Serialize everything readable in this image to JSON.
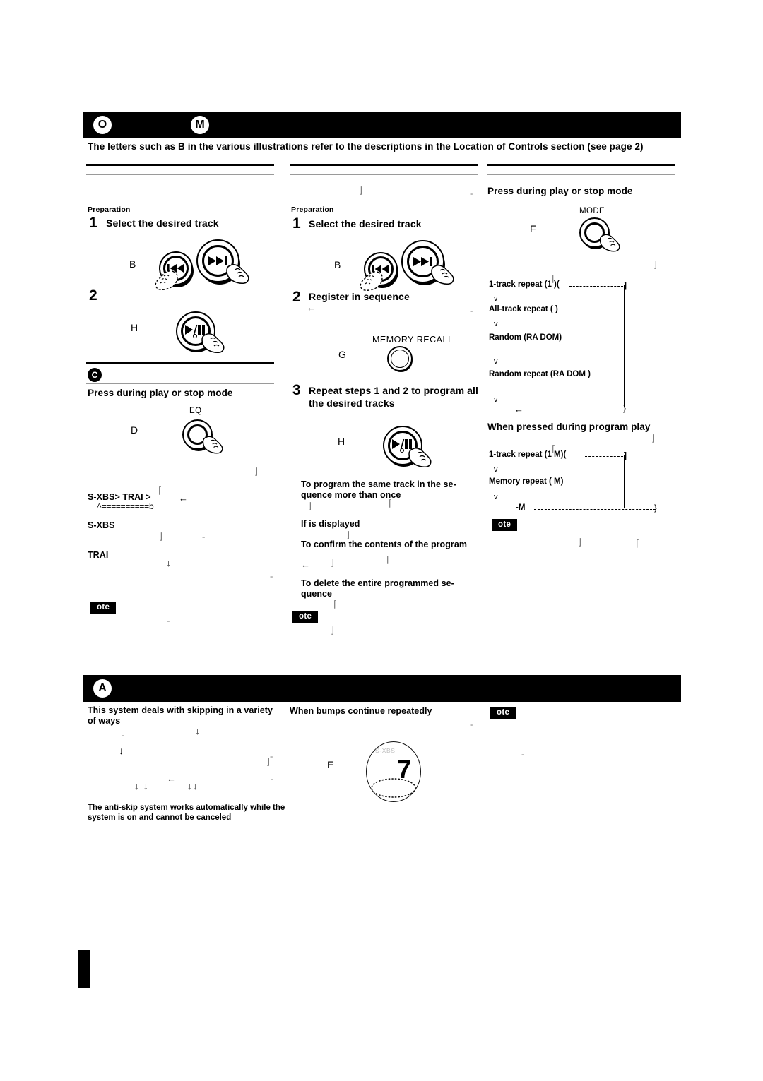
{
  "page": {
    "intro_note": "The letters such as B  in the various illustrations refer to the descriptions in the  Location of Controls   section (see page 2)"
  },
  "header_bar_top": {
    "badge_left": "O",
    "badge_right": "M"
  },
  "header_bar_bottom": {
    "badge_left": "A"
  },
  "column1": {
    "preparation_label": "Preparation",
    "step1_num": "1",
    "step1_title": "Select the desired track",
    "step1_letter": "B",
    "step2_num": "2",
    "step2_letter": "H",
    "section_badge": "C",
    "section_title": "Press during play or stop mode",
    "button_letter": "D",
    "button_caption": "EQ",
    "flow_line1": "S-XBS>  TRAI  >",
    "flow_line1_arrow": "←",
    "flow_line2": "^==========b",
    "item1": "S-XBS",
    "item2": "TRAI",
    "note_badge": "ote"
  },
  "column2": {
    "preparation_label": "Preparation",
    "step1_num": "1",
    "step1_title": "Select the desired track",
    "step1_letter": "B",
    "step2_num": "2",
    "step2_title": "Register in sequence",
    "step2_arrow": "←",
    "memory_letter": "G",
    "memory_caption": "MEMORY RECALL",
    "step3_num": "3",
    "step3_title_line1": "Repeat steps  1 and 2 to program all",
    "step3_title_line2": "the desired tracks",
    "step3_letter": "H",
    "sub1_line1": "To  program  the  same  track  in  the  se-",
    "sub1_line2": "quence more than once",
    "sub2": "If       is displayed",
    "sub3": "To confirm the contents of the program",
    "sub3_arrow": "←",
    "sub4_line1": "To  delete  the  entire  programmed  se-",
    "sub4_line2": "quence",
    "note_badge": "ote"
  },
  "column3": {
    "section_title": "Press during play or stop mode",
    "button_letter": "F",
    "button_caption": "MODE",
    "modes": [
      "1-track repeat (1           )(",
      "All-track repeat (          )",
      "Random (RA   DOM)",
      "Random repeat (RA   DOM        )"
    ],
    "mode_end_bracket": "]",
    "mode_loop_arrow": "←",
    "program_title": "When pressed during program play",
    "program_modes": [
      "1-track repeat (1             M)(",
      "Memory repeat (          M)",
      "-M"
    ],
    "program_end_bracket": "]",
    "note_badge": "ote"
  },
  "bottom_section": {
    "col1_heading_line1": "This  system  deals  with  skipping  in  a  variety",
    "col1_heading_line2": "of ways",
    "col1_footer_line1": "The anti-skip system works automatically while the",
    "col1_footer_line2": "system is on and cannot be canceled",
    "col2_heading": "When bumps continue repeatedly",
    "col2_letter": "E",
    "disc_label": "S-XBS",
    "disc_number": "7",
    "note_badge": "ote"
  },
  "arrow_down_glyph": "↓",
  "arrow_left_glyph": "←",
  "chevron_down_glyph": "v",
  "colors": {
    "bar": "#000000",
    "rule_thick": "#000000",
    "rule_thin": "#9a9a9a",
    "page_bg": "#ffffff"
  }
}
